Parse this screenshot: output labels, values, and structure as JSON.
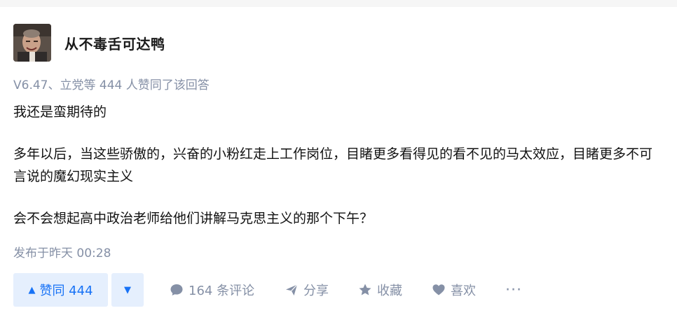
{
  "author": {
    "name": "从不毒舌可达鸭"
  },
  "voters_summary": "V6.47、立党等 444 人赞同了该回答",
  "content": {
    "paragraphs": [
      "我还是蛮期待的",
      "多年以后，当这些骄傲的，兴奋的小粉红走上工作岗位，目睹更多看得见的看不见的马太效应，目睹更多不可言说的魔幻现实主义",
      "会不会想起高中政治老师给他们讲解马克思主义的那个下午？"
    ]
  },
  "publish_time": "发布于昨天 00:28",
  "actions": {
    "vote_up_label": "赞同 444",
    "comments_label": "164 条评论",
    "share_label": "分享",
    "collect_label": "收藏",
    "like_label": "喜欢",
    "more_label": "···"
  },
  "colors": {
    "accent": "#1772f6",
    "accent_bg": "#e5effd",
    "meta_text": "#8590a6"
  },
  "icons": [
    "avatar",
    "triangle-up-icon",
    "triangle-down-icon",
    "comment-icon",
    "share-icon",
    "star-icon",
    "heart-icon",
    "more-icon"
  ]
}
